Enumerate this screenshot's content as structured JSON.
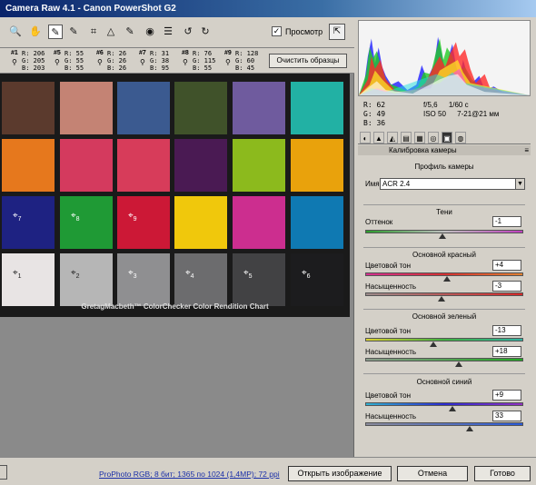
{
  "window": {
    "title": "Camera Raw 4.1  -  Canon PowerShot G2"
  },
  "toolbar": {
    "tools": [
      {
        "name": "zoom-icon",
        "glyph": "🔍"
      },
      {
        "name": "hand-icon",
        "glyph": "✋"
      },
      {
        "name": "white-balance-icon",
        "glyph": "✎"
      },
      {
        "name": "color-sampler-icon",
        "glyph": "✎"
      },
      {
        "name": "crop-icon",
        "glyph": "⌗"
      },
      {
        "name": "straighten-icon",
        "glyph": "△"
      },
      {
        "name": "retouch-icon",
        "glyph": "✎"
      },
      {
        "name": "red-eye-icon",
        "glyph": "◉"
      },
      {
        "name": "preferences-icon",
        "glyph": "☰"
      },
      {
        "name": "rotate-left-icon",
        "glyph": "↺"
      },
      {
        "name": "rotate-right-icon",
        "glyph": "↻"
      }
    ],
    "preview_label": "Просмотр",
    "preview_checked": "✓",
    "fullscreen_glyph": "⇱"
  },
  "samplers": [
    {
      "num": "#1",
      "r": "R:  206",
      "g": "G:  205",
      "b": "B:  203"
    },
    {
      "num": "#5",
      "r": "R:   55",
      "g": "G:   55",
      "b": "B:   55"
    },
    {
      "num": "#6",
      "r": "R:   26",
      "g": "G:   26",
      "b": "B:   26"
    },
    {
      "num": "#7",
      "r": "R:   31",
      "g": "G:   38",
      "b": "B:   95"
    },
    {
      "num": "#8",
      "r": "R:   76",
      "g": "G:  115",
      "b": "B:   55"
    },
    {
      "num": "#9",
      "r": "R:  128",
      "g": "G:   60",
      "b": "B:   45"
    }
  ],
  "sampler_pin": "⚲",
  "clear_samplers_label": "Очистить образцы",
  "chart": {
    "label": "GretagMacbeth™ ColorChecker Color Rendition Chart",
    "swatches": [
      {
        "color": "#5b3a2d",
        "marker": ""
      },
      {
        "color": "#c48374",
        "marker": ""
      },
      {
        "color": "#3b5a90",
        "marker": ""
      },
      {
        "color": "#40522a",
        "marker": ""
      },
      {
        "color": "#6f5b9e",
        "marker": ""
      },
      {
        "color": "#22b1a4",
        "marker": ""
      },
      {
        "color": "#e6781d",
        "marker": ""
      },
      {
        "color": "#d43a5e",
        "marker": ""
      },
      {
        "color": "#d73c5a",
        "marker": ""
      },
      {
        "color": "#4a1a53",
        "marker": ""
      },
      {
        "color": "#8cba1d",
        "marker": ""
      },
      {
        "color": "#e9a20c",
        "marker": ""
      },
      {
        "color": "#1e2282",
        "marker": "7"
      },
      {
        "color": "#1f9a35",
        "marker": "8"
      },
      {
        "color": "#cc1836",
        "marker": "9"
      },
      {
        "color": "#f0c80c",
        "marker": ""
      },
      {
        "color": "#cc2e8f",
        "marker": ""
      },
      {
        "color": "#0f79b2",
        "marker": ""
      },
      {
        "color": "#e8e4e4",
        "marker": "1"
      },
      {
        "color": "#b6b6b6",
        "marker": "2"
      },
      {
        "color": "#8f8f91",
        "marker": "3"
      },
      {
        "color": "#6c6c6e",
        "marker": "4"
      },
      {
        "color": "#424244",
        "marker": "5"
      },
      {
        "color": "#1c1c1e",
        "marker": "6"
      }
    ],
    "marker_glyph": "⌖"
  },
  "readout": {
    "r": "R:    62",
    "g": "G:    49",
    "b": "B:    36",
    "aperture": "f/5,6",
    "shutter": "1/60 с",
    "iso": "ISO 50",
    "focal": "7-21@21 мм"
  },
  "tabs": [
    "◐",
    "▲",
    "◭",
    "▤",
    "▦",
    "◎",
    "▣",
    "◍"
  ],
  "panel": {
    "title": "Калибровка камеры",
    "menu_glyph": "≡",
    "profile_heading": "Профиль камеры",
    "name_label": "Имя:",
    "profile_value": "ACR 2.4",
    "select_arrow": "▼",
    "shadows": {
      "heading": "Тени",
      "tint_label": "Оттенок",
      "tint_value": "-1",
      "tint_level": 0.49
    },
    "red": {
      "heading": "Основной красный",
      "hue_label": "Цветовой тон",
      "hue_value": "+4",
      "hue_level": 0.52,
      "sat_label": "Насыщенность",
      "sat_value": "-3",
      "sat_level": 0.48
    },
    "green": {
      "heading": "Основной зеленый",
      "hue_label": "Цветовой тон",
      "hue_value": "-13",
      "hue_level": 0.43,
      "sat_label": "Насыщенность",
      "sat_value": "+18",
      "sat_level": 0.59
    },
    "blue": {
      "heading": "Основной синий",
      "hue_label": "Цветовой тон",
      "hue_value": "+9",
      "hue_level": 0.55,
      "sat_label": "Насыщенность",
      "sat_value": "33",
      "sat_level": 0.66
    }
  },
  "footer": {
    "info": "ProPhoto RGB; 8 бит; 1365 по 1024 (1,4МР); 72 ppi",
    "open_label": "Открыть изображение",
    "cancel_label": "Отмена",
    "done_label": "Готово"
  },
  "colors": {
    "accent_link": "#1a2fa8",
    "chart_bg": "#1a1a1a",
    "canvas_bg": "#8a8a8a"
  }
}
